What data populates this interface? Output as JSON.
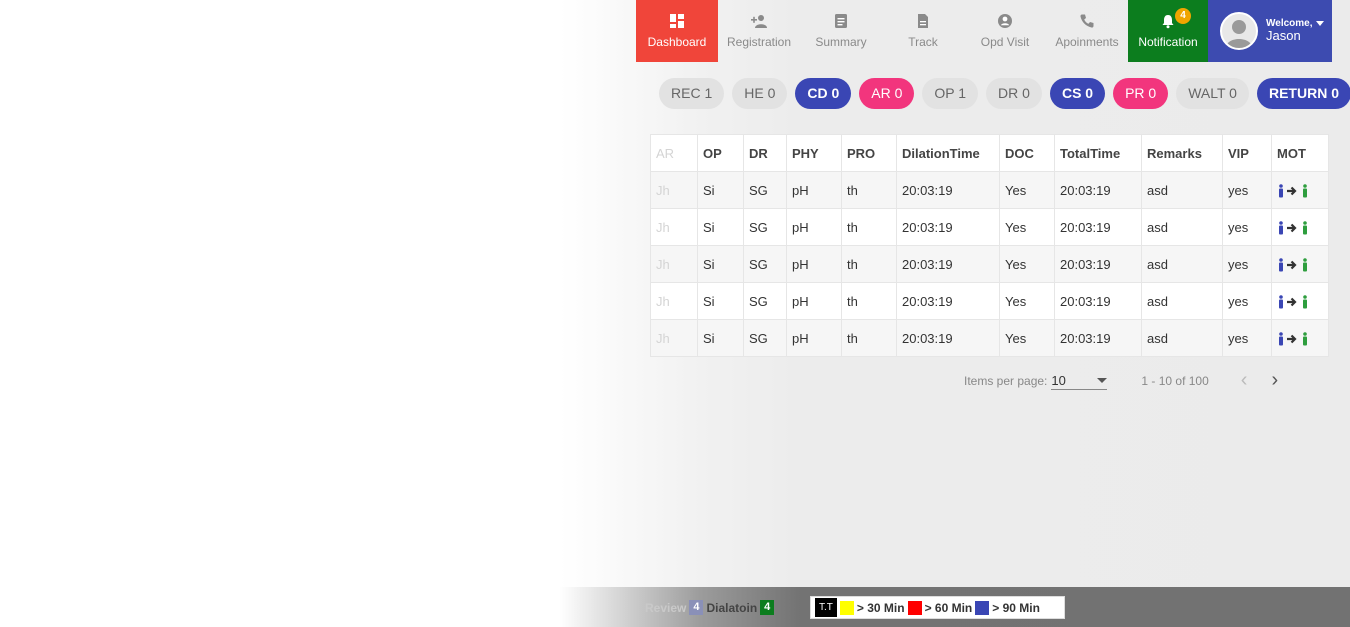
{
  "nav": {
    "items": [
      {
        "label": "Dashboard",
        "icon": "dashboard-icon"
      },
      {
        "label": "Registration",
        "icon": "add-person-icon"
      },
      {
        "label": "Summary",
        "icon": "clipboard-icon"
      },
      {
        "label": "Track",
        "icon": "document-icon"
      },
      {
        "label": "Opd Visit",
        "icon": "account-circle-icon"
      },
      {
        "label": "Apoinments",
        "icon": "phone-icon"
      }
    ],
    "notification": {
      "label": "Notification",
      "count": "4",
      "icon": "bell-icon"
    },
    "user": {
      "welcome": "Welcome,",
      "name": "Jason"
    }
  },
  "status_pills": [
    "REC 1",
    "HE 0",
    "CD 0",
    "AR 0",
    "OP 1",
    "DR 0",
    "CS 0",
    "PR 0",
    "WALT 0",
    "RETURN 0"
  ],
  "table": {
    "columns": [
      "AR",
      "OP",
      "DR",
      "PHY",
      "PRO",
      "DilationTime",
      "DOC",
      "TotalTime",
      "Remarks",
      "VIP",
      "MOT"
    ],
    "rows": [
      [
        "Jh",
        "Si",
        "SG",
        "pH",
        "th",
        "20:03:19",
        "Yes",
        "20:03:19",
        "asd",
        "yes"
      ],
      [
        "Jh",
        "Si",
        "SG",
        "pH",
        "th",
        "20:03:19",
        "Yes",
        "20:03:19",
        "asd",
        "yes"
      ],
      [
        "Jh",
        "Si",
        "SG",
        "pH",
        "th",
        "20:03:19",
        "Yes",
        "20:03:19",
        "asd",
        "yes"
      ],
      [
        "Jh",
        "Si",
        "SG",
        "pH",
        "th",
        "20:03:19",
        "Yes",
        "20:03:19",
        "asd",
        "yes"
      ],
      [
        "Jh",
        "Si",
        "SG",
        "pH",
        "th",
        "20:03:19",
        "Yes",
        "20:03:19",
        "asd",
        "yes"
      ]
    ]
  },
  "paginator": {
    "items_per_page_label": "Items per page:",
    "page_size": "10",
    "range": "1 - 10 of 100"
  },
  "footer": {
    "review_label": "Review",
    "review_count": "4",
    "dilation_label": "Dialatoin",
    "dilation_count": "4",
    "tt_label": "T.T",
    "legend": [
      "> 30 Min",
      "> 60 Min",
      "> 90 Min"
    ]
  },
  "colors": {
    "dashboard_active": "#f0453a",
    "notification": "#0c7d1e",
    "user": "#3d4bb0",
    "blue_pill": "#3a46b4",
    "pink_pill": "#f2357d",
    "legend_yellow": "#ffff00",
    "legend_red": "#ff0000",
    "legend_blue": "#3a46b4"
  }
}
